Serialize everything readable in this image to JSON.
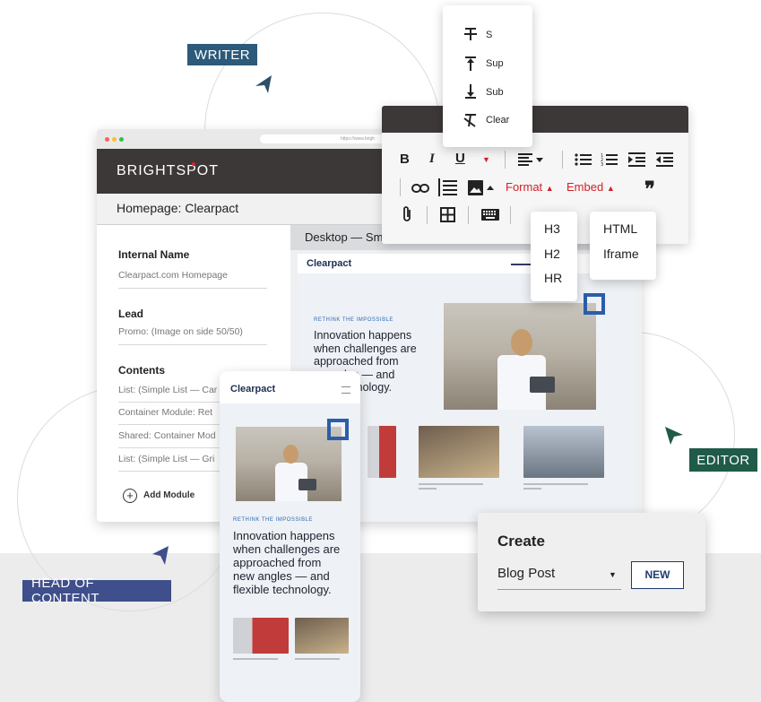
{
  "labels": {
    "writer": "WRITER",
    "editor": "EDITOR",
    "head_of_content": "HEAD OF CONTENT"
  },
  "colors": {
    "writer_tag": "#2c5a7a",
    "editor_tag": "#1f5b48",
    "head_tag": "#3e4f8b",
    "cms_bar": "#3d3838",
    "accent_red": "#d4202a"
  },
  "browser": {
    "url": "https://www.brigh",
    "app_logo": "BRIGHTSPOT",
    "page_title": "Homepage: Clearpact",
    "form": {
      "internal_name_label": "Internal Name",
      "internal_name_value": "Clearpact.com Homepage",
      "lead_label": "Lead",
      "lead_value": "Promo: (Image on side 50/50)",
      "contents_label": "Contents",
      "contents_items": [
        "List: (Simple List — Car",
        "Container Module: Ret",
        "Shared: Container Mod",
        "List: (Simple List — Gri"
      ],
      "add_module": "Add Module"
    },
    "preview": {
      "title": "Desktop — Sm",
      "site_brand": "Clearpact",
      "kicker": "RETHINK THE IMPOSSIBLE",
      "hero_lines": [
        "Innovation happens",
        "when challenges are",
        "approached from",
        "les — and",
        "technology."
      ]
    }
  },
  "phone": {
    "site_brand": "Clearpact",
    "kicker": "RETHINK THE IMPOSSIBLE",
    "hero_lines": [
      "Innovation happens",
      "when challenges are",
      "approached from",
      "new angles — and",
      "flexible technology."
    ]
  },
  "toolbar": {
    "bold": "B",
    "italic": "I",
    "underline": "U",
    "format_label": "Format",
    "embed_label": "Embed",
    "quote": "❞",
    "strike_menu": [
      {
        "icon": "strikethrough-icon",
        "label": "S"
      },
      {
        "icon": "superscript-icon",
        "label": "Sup"
      },
      {
        "icon": "subscript-icon",
        "label": "Sub"
      },
      {
        "icon": "clear-format-icon",
        "label": "Clear"
      }
    ],
    "format_menu": [
      "H3",
      "H2",
      "HR"
    ],
    "embed_menu": [
      "HTML",
      "Iframe"
    ]
  },
  "create_panel": {
    "title": "Create",
    "selected": "Blog Post",
    "new_button": "NEW"
  }
}
